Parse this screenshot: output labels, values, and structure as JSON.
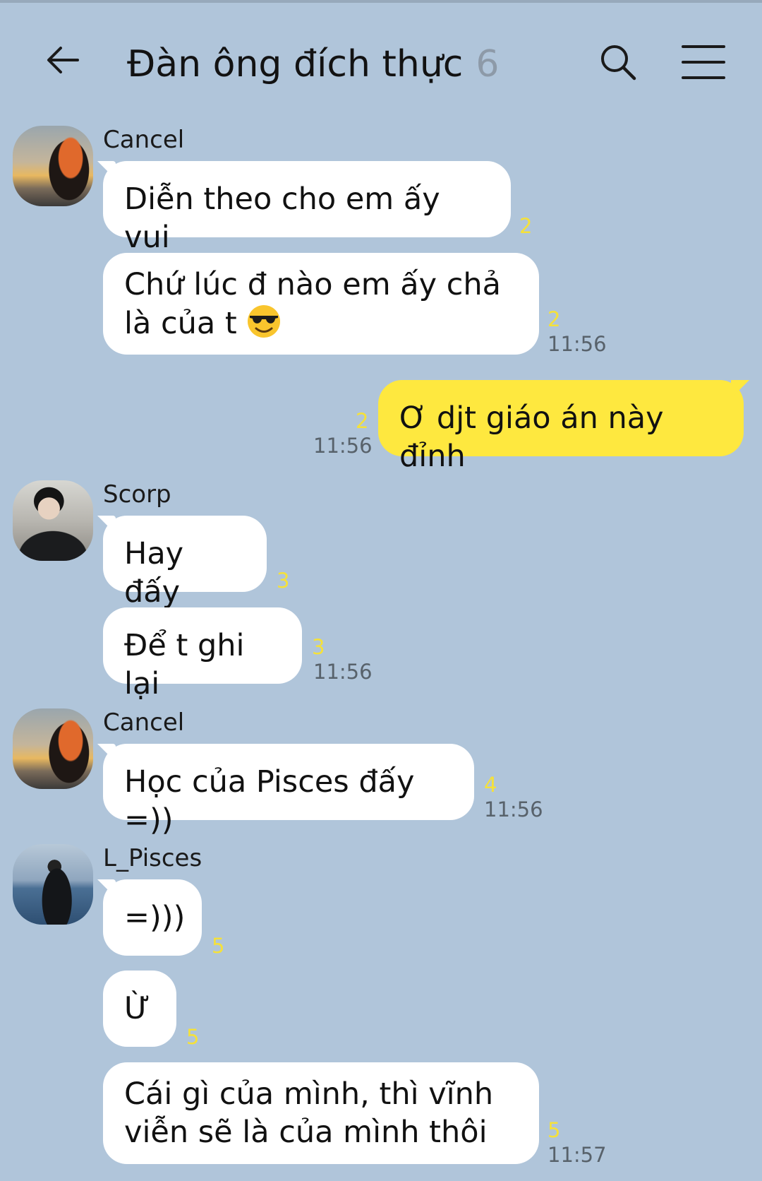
{
  "header": {
    "title": "Đàn ông đích thực",
    "member_count": "6",
    "icons": {
      "back": "arrow-left-icon",
      "search": "search-icon",
      "menu": "hamburger-menu-icon"
    }
  },
  "colors": {
    "background": "#b0c5da",
    "my_bubble": "#fee83f",
    "their_bubble": "#ffffff",
    "unread_count": "#f5e13a"
  },
  "messages": [
    {
      "sender": "Cancel",
      "text": "Diễn theo cho em ấy vui",
      "unread": "2",
      "time": ""
    },
    {
      "sender": "Cancel",
      "text_line1": "Chứ lúc đ nào em ấy chả",
      "text_line2": "là của t",
      "emoji": "sunglasses-face-emoji",
      "unread": "2",
      "time": "11:56"
    },
    {
      "sender": "me",
      "text": "Ơ djt giáo án này đỉnh",
      "unread": "2",
      "time": "11:56"
    },
    {
      "sender": "Scorp",
      "text": "Hay đấy",
      "unread": "3",
      "time": ""
    },
    {
      "sender": "Scorp",
      "text": "Để t ghi lại",
      "unread": "3",
      "time": "11:56"
    },
    {
      "sender": "Cancel",
      "text": "Học của Pisces đấy =))",
      "unread": "4",
      "time": "11:56"
    },
    {
      "sender": "L_Pisces",
      "text": "=)))",
      "unread": "5",
      "time": ""
    },
    {
      "sender": "L_Pisces",
      "text": "Ừ",
      "unread": "5",
      "time": ""
    },
    {
      "sender": "L_Pisces",
      "text_line1": "Cái gì của mình, thì vĩnh",
      "text_line2": "viễn sẽ là của mình thôi",
      "unread": "5",
      "time": "11:57"
    }
  ]
}
